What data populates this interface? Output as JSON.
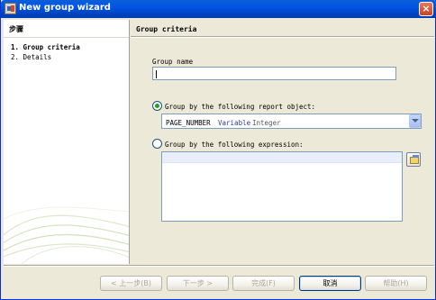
{
  "window": {
    "title": "New group wizard",
    "close_glyph": "×"
  },
  "steps_panel": {
    "header": "步骤",
    "steps": [
      {
        "label": "1.  Group criteria",
        "active": true
      },
      {
        "label": "2.  Details",
        "active": false
      }
    ]
  },
  "main": {
    "section_title": "Group criteria",
    "group_name_label": "Group name",
    "group_name_value": "",
    "report_object_option": {
      "label": "Group by the following report object:",
      "selected": true
    },
    "report_object_combo": {
      "name": "PAGE_NUMBER",
      "kind": "Variable",
      "type": "Integer"
    },
    "expression_option": {
      "label": "Group by the following expression:",
      "selected": false
    },
    "expression_value": ""
  },
  "buttons": {
    "back": "< 上一步(B)",
    "next": "下一步 >",
    "finish": "完成(F)",
    "cancel": "取消",
    "help": "帮助(H)"
  },
  "colors": {
    "titlebar": "#0054e3",
    "radio_dot": "#21a121",
    "variable_text": "#2b39a8"
  }
}
